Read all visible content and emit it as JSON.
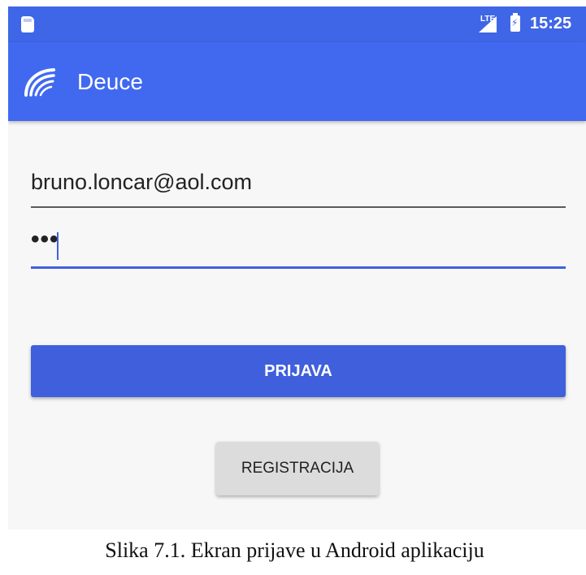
{
  "status_bar": {
    "network_label": "LTE",
    "time": "15:25",
    "icons": [
      "sd-card-icon",
      "signal-icon",
      "battery-charging-icon"
    ]
  },
  "app_bar": {
    "title": "Deuce",
    "logo_icon": "deuce-logo-icon"
  },
  "login_form": {
    "email_value": "bruno.loncar@aol.com",
    "password_masked": "•••",
    "login_button_label": "PRIJAVA",
    "register_button_label": "REGISTRACIJA"
  },
  "caption": "Slika 7.1. Ekran prijave u Android aplikaciju",
  "colors": {
    "status_bar": "#3f66e6",
    "app_bar": "#4169f0",
    "primary_button": "#3f5fdc",
    "secondary_button": "#dcdcdc",
    "focus_underline": "#3f5fe0",
    "background": "#f7f7f7"
  }
}
